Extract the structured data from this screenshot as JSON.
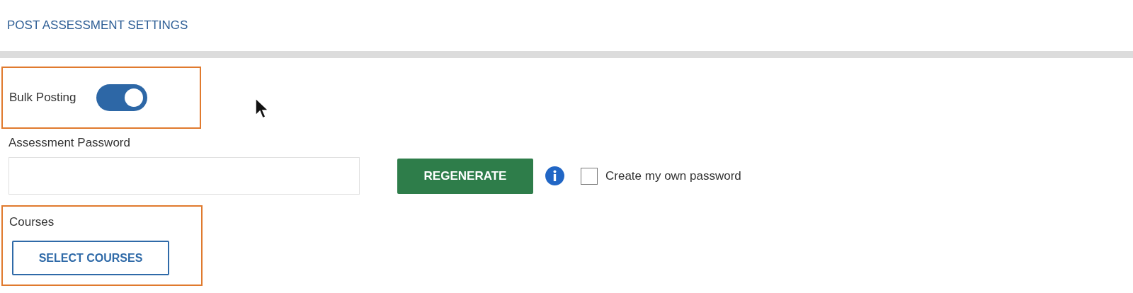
{
  "header": {
    "title": "POST ASSESSMENT SETTINGS"
  },
  "bulk_posting": {
    "label": "Bulk Posting",
    "on": true,
    "highlighted": true
  },
  "password": {
    "label": "Assessment Password",
    "regenerate_button": "REGENERATE"
  },
  "own_password": {
    "label": "Create my own password",
    "checked": false
  },
  "courses": {
    "label": "Courses",
    "button": "SELECT COURSES",
    "highlighted": true
  }
}
